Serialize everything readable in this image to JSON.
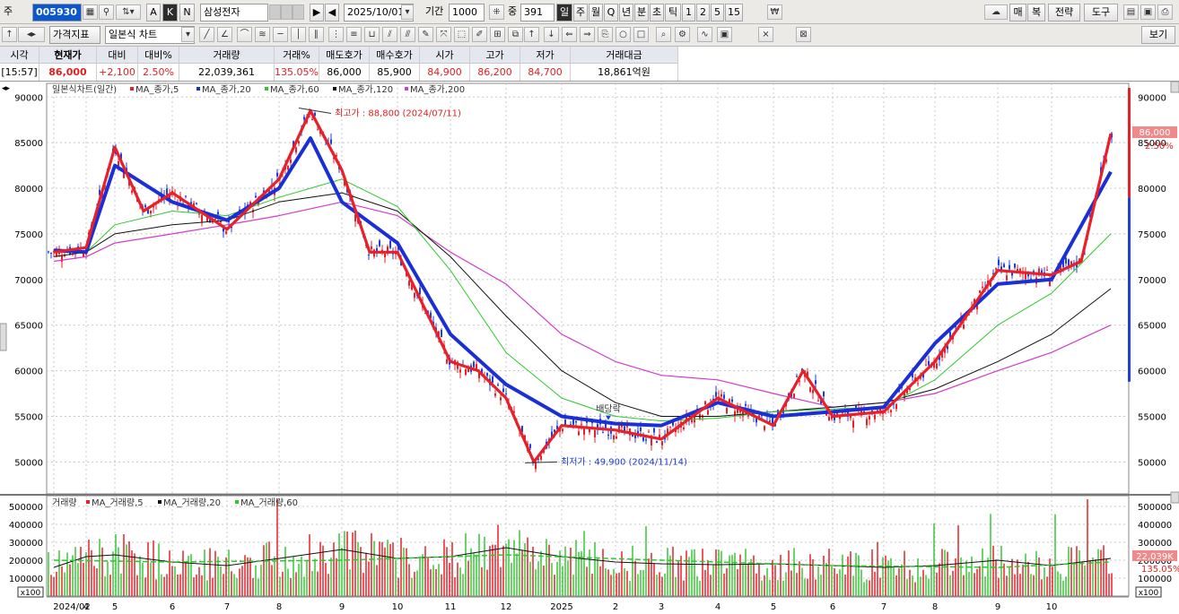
{
  "toolbar1": {
    "market_label": "주",
    "stock_code": "005930",
    "btn_a": "A",
    "btn_k": "K",
    "btn_n": "N",
    "stock_name": "삼성전자",
    "date": "2025/10/01",
    "period_label": "기간",
    "period_value": "1000",
    "count_label": "중",
    "count_value": "391",
    "periods": [
      "일",
      "주",
      "월",
      "Q",
      "년",
      "분",
      "초",
      "틱",
      "1",
      "2",
      "5",
      "15"
    ],
    "active_period": "일",
    "right_buttons": [
      "매",
      "복",
      "전략",
      "도구"
    ]
  },
  "toolbar2": {
    "indicator_select": "가격지표",
    "chart_type_select": "일본식 차트",
    "view_button": "보기"
  },
  "quote": {
    "headers": [
      "시각",
      "현재가",
      "대비",
      "대비%",
      "거래량",
      "거래%",
      "매도호가",
      "매수호가",
      "시가",
      "고가",
      "저가",
      "거래대금"
    ],
    "values": [
      "[15:57]",
      "86,000",
      "+2,100",
      "2.50%",
      "22,039,361",
      "135.05%",
      "86,000",
      "85,900",
      "84,900",
      "86,200",
      "84,700",
      "18,861억원"
    ]
  },
  "colors": {
    "up": "#e8202a",
    "down": "#1f3fd6",
    "ma5": "#e8202a",
    "ma20": "#1a2fd6",
    "ma60": "#2ec82e",
    "ma120": "#111111",
    "ma200": "#d23cc8",
    "vol_ma5": "#e8202a",
    "vol_ma20": "#111111",
    "vol_ma60": "#2ec82e"
  },
  "chart_data": [
    {
      "type": "line",
      "title": "일본식차트(일간)",
      "legend": [
        "MA_종가,5",
        "MA_종가,20",
        "MA_종가,60",
        "MA_종가,120",
        "MA_종가,200"
      ],
      "legend_placement": "top-left",
      "grid": true,
      "x_tick_labels": [
        "2024/02",
        "4",
        "5",
        "6",
        "7",
        "8",
        "9",
        "10",
        "11",
        "12",
        "2025",
        "2",
        "3",
        "4",
        "5",
        "6",
        "7",
        "8",
        "9",
        "10"
      ],
      "y_tick_labels": [
        "50000",
        "55000",
        "60000",
        "65000",
        "70000",
        "75000",
        "80000",
        "85000",
        "90000"
      ],
      "ylim": [
        46500,
        91500
      ],
      "series": [
        {
          "name": "MA_종가,5",
          "x": [
            "2024/02",
            "2024/03",
            "2024/04",
            "2024/04",
            "2024/05",
            "2024/06",
            "2024/07",
            "2024/07",
            "2024/08",
            "2024/08",
            "2024/09",
            "2024/10",
            "2024/10",
            "2024/11",
            "2024/11",
            "2024/12",
            "2025/01",
            "2025/02",
            "2025/03",
            "2025/04",
            "2025/04",
            "2025/05",
            "2025/06",
            "2025/07",
            "2025/08",
            "2025/09",
            "2025/09",
            "2025/10"
          ],
          "values": [
            73000,
            73500,
            84500,
            77500,
            79500,
            75500,
            81000,
            88500,
            82000,
            73000,
            73000,
            61000,
            60000,
            57000,
            50000,
            54000,
            53500,
            52500,
            57000,
            54000,
            60000,
            55000,
            55500,
            61000,
            71000,
            70500,
            72000,
            86000
          ]
        },
        {
          "name": "MA_종가,20",
          "x": [
            "2024/02",
            "2024/03",
            "2024/04",
            "2024/05",
            "2024/06",
            "2024/07",
            "2024/07",
            "2024/08",
            "2024/09",
            "2024/10",
            "2024/11",
            "2024/12",
            "2025/01",
            "2025/02",
            "2025/03",
            "2025/04",
            "2025/05",
            "2025/06",
            "2025/07",
            "2025/08",
            "2025/09",
            "2025/10"
          ],
          "values": [
            73200,
            73000,
            82500,
            78500,
            76500,
            80000,
            85500,
            78500,
            74000,
            64000,
            58500,
            55000,
            54200,
            54000,
            56500,
            55000,
            55500,
            56000,
            63000,
            69500,
            70000,
            81800
          ]
        },
        {
          "name": "MA_종가,60",
          "x": [
            "2024/02",
            "2024/03",
            "2024/04",
            "2024/05",
            "2024/06",
            "2024/07",
            "2024/08",
            "2024/09",
            "2024/10",
            "2024/11",
            "2024/12",
            "2025/01",
            "2025/02",
            "2025/03",
            "2025/04",
            "2025/05",
            "2025/06",
            "2025/07",
            "2025/08",
            "2025/09",
            "2025/10"
          ],
          "values": [
            73000,
            73000,
            76000,
            77500,
            77000,
            79000,
            81000,
            78000,
            71000,
            62000,
            57000,
            55000,
            54500,
            54800,
            55500,
            55800,
            56000,
            59000,
            65000,
            68500,
            75000
          ]
        },
        {
          "name": "MA_종가,120",
          "x": [
            "2024/02",
            "2024/03",
            "2024/04",
            "2024/05",
            "2024/06",
            "2024/07",
            "2024/08",
            "2024/09",
            "2024/10",
            "2024/11",
            "2024/12",
            "2025/01",
            "2025/02",
            "2025/03",
            "2025/04",
            "2025/05",
            "2025/06",
            "2025/07",
            "2025/08",
            "2025/09",
            "2025/10"
          ],
          "values": [
            72500,
            73000,
            75000,
            76000,
            76500,
            78500,
            79500,
            77500,
            72500,
            66000,
            60000,
            56500,
            55000,
            55000,
            55500,
            56000,
            56500,
            58000,
            61000,
            64000,
            69000
          ]
        },
        {
          "name": "MA_종가,200",
          "x": [
            "2024/02",
            "2024/03",
            "2024/04",
            "2024/05",
            "2024/06",
            "2024/07",
            "2024/08",
            "2024/09",
            "2024/10",
            "2024/11",
            "2024/12",
            "2025/01",
            "2025/02",
            "2025/03",
            "2025/04",
            "2025/05",
            "2025/06",
            "2025/07",
            "2025/08",
            "2025/09",
            "2025/10"
          ],
          "values": [
            72000,
            72500,
            74000,
            75000,
            76000,
            77000,
            78500,
            77000,
            73000,
            69500,
            64000,
            61000,
            59500,
            59000,
            57500,
            56000,
            56500,
            57500,
            60000,
            62000,
            65000
          ]
        }
      ],
      "annotations": [
        {
          "text": "최고가 : 88,800 (2024/07/11)",
          "x": "2024/07/11",
          "y": 88800
        },
        {
          "text": "최저가 : 49,900 (2024/11/14)",
          "x": "2024/11/14",
          "y": 49900
        },
        {
          "text": "배당락",
          "x": "2024/12/27",
          "y": 54500
        }
      ],
      "last_value_label": "86,000",
      "last_change_label": "2.50%"
    },
    {
      "type": "bar",
      "title": "거래량",
      "legend": [
        "MA_거래량,5",
        "MA_거래량,20",
        "MA_거래량,60"
      ],
      "legend_placement": "top-left",
      "grid": true,
      "y_tick_labels": [
        "100000",
        "200000",
        "300000",
        "400000",
        "500000"
      ],
      "y_unit_label": "x100",
      "ylim": [
        0,
        560000
      ],
      "series": [
        {
          "name": "MA_거래량,20",
          "x": [
            "2024/02",
            "2024/03",
            "2024/04",
            "2024/05",
            "2024/06",
            "2024/07",
            "2024/08",
            "2024/09",
            "2024/10",
            "2024/11",
            "2024/12",
            "2025/01",
            "2025/02",
            "2025/03",
            "2025/04",
            "2025/05",
            "2025/06",
            "2025/07",
            "2025/08",
            "2025/09",
            "2025/10"
          ],
          "values": [
            160000,
            220000,
            230000,
            190000,
            170000,
            210000,
            260000,
            210000,
            220000,
            270000,
            220000,
            190000,
            180000,
            175000,
            180000,
            170000,
            160000,
            170000,
            200000,
            170000,
            210000
          ]
        },
        {
          "name": "MA_거래량,60",
          "x": [
            "2024/02",
            "2024/05",
            "2024/08",
            "2024/11",
            "2025/02",
            "2025/05",
            "2025/08",
            "2025/10"
          ],
          "values": [
            200000,
            190000,
            200000,
            230000,
            200000,
            170000,
            160000,
            190000
          ]
        }
      ],
      "last_value_label": "22,039K",
      "last_change_label": "135.05%"
    }
  ]
}
